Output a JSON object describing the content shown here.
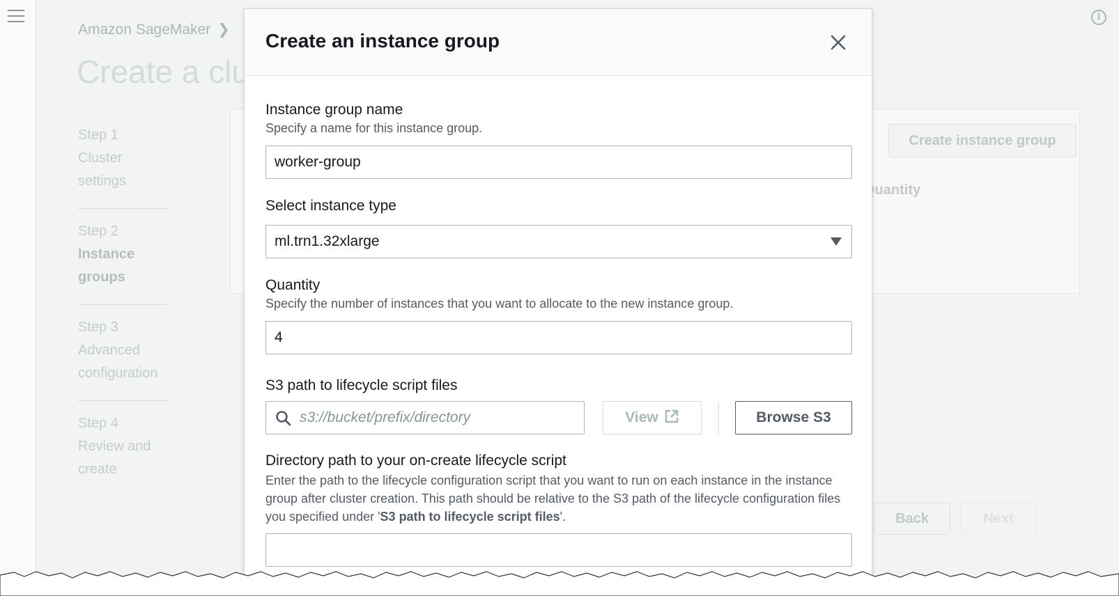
{
  "background": {
    "breadcrumb": "Amazon SageMaker",
    "page_title": "Create a clus",
    "steps": [
      {
        "step": "Step 1",
        "title": "Cluster settings",
        "active": false
      },
      {
        "step": "Step 2",
        "title": "Instance groups",
        "active": true
      },
      {
        "step": "Step 3",
        "title": "Advanced configuration",
        "active": false
      },
      {
        "step": "Step 4",
        "title": "Review and create",
        "active": false
      }
    ],
    "create_instance_group_label": "Create instance group",
    "quantity_header": "Quantity",
    "back_label": "Back",
    "next_label": "Next"
  },
  "modal": {
    "title": "Create an instance group",
    "group_name": {
      "label": "Instance group name",
      "description": "Specify a name for this instance group.",
      "value": "worker-group"
    },
    "instance_type": {
      "label": "Select instance type",
      "value": "ml.trn1.32xlarge"
    },
    "quantity": {
      "label": "Quantity",
      "description": "Specify the number of instances that you want to allocate to the new instance group.",
      "value": "4"
    },
    "s3_path": {
      "label": "S3 path to lifecycle script files",
      "placeholder": "s3://bucket/prefix/directory",
      "view_label": "View",
      "browse_label": "Browse S3"
    },
    "directory_path": {
      "label": "Directory path to your on-create lifecycle script",
      "description_prefix": "Enter the path to the lifecycle configuration script that you want to run on each instance in the instance group after cluster creation. This path should be relative to the S3 path of the lifecycle configuration files you specified under '",
      "description_bold": "S3 path to lifecycle script files",
      "description_suffix": "'.",
      "value": ""
    }
  },
  "icons": [
    "hamburger-icon",
    "info-icon",
    "chevron-right-icon",
    "close-icon",
    "caret-down-icon",
    "search-icon",
    "external-link-icon"
  ],
  "colors": {
    "text": "#16191f",
    "secondary_text": "#545b64",
    "border": "#aab7b8",
    "background_page": "#f2f3f3"
  }
}
